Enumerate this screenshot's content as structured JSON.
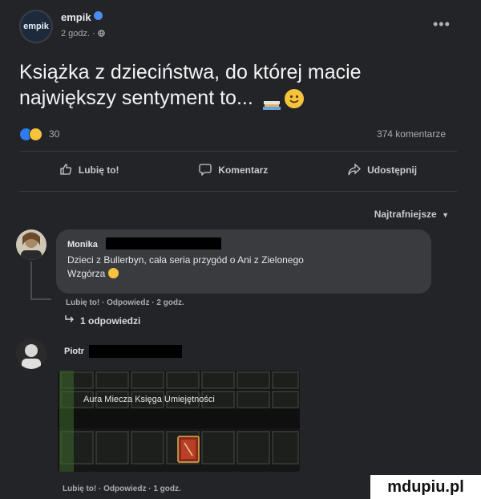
{
  "post": {
    "page_name": "empik",
    "avatar_text": "empik",
    "meta": "2 godz. · ",
    "text_line1": "Książka z dzieciństwa, do której macie",
    "text_line2": "największy sentyment to... ",
    "reaction_count": "30",
    "comment_count": "374 komentarze"
  },
  "actions": {
    "like": "Lubię to!",
    "comment": "Komentarz",
    "share": "Udostępnij"
  },
  "sort_label": "Najtrafniejsze",
  "comments": [
    {
      "name": "Monika",
      "text_line1": "Dzieci z Bullerbyn, cała seria przygód o Ani z Zielonego",
      "text_line2": "Wzgórza ",
      "like": "Lubię to!",
      "reply": "Odpowiedz",
      "time": "2 godz.",
      "replies": "1 odpowiedzi"
    },
    {
      "name": "Piotr",
      "image_text": "Aura Miecza Księga Umiejętności",
      "like": "Lubię to!",
      "reply": "Odpowiedz",
      "time": "1 godz."
    }
  ],
  "watermark": "mdupiu.pl",
  "colors": {
    "background": "#232427",
    "bubble": "#3a3b3e",
    "like_blue": "#2d7cf2",
    "emoji_yellow": "#f6c43a"
  },
  "icons": [
    "more-icon",
    "globe-icon",
    "like-icon",
    "comment-icon",
    "share-icon",
    "caret-down-icon",
    "reply-arrow-icon",
    "smile-icon",
    "books-icon"
  ]
}
